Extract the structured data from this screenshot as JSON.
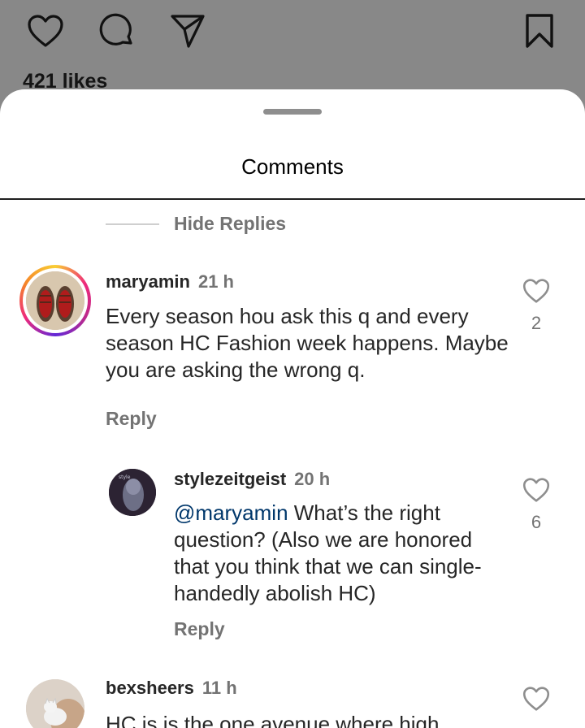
{
  "post": {
    "likes": "421 likes",
    "icons": [
      "heart-icon",
      "comment-icon",
      "share-icon",
      "bookmark-icon"
    ]
  },
  "sheet": {
    "title": "Comments",
    "hide_replies": "Hide Replies"
  },
  "comments": [
    {
      "username": "maryamin",
      "time": "21 h",
      "text": "Every season hou ask this q and every season HC Fashion week happens. Maybe you are asking the wrong q.",
      "reply": "Reply",
      "likes": "2"
    },
    {
      "username": "stylezeitgeist",
      "time": "20 h",
      "mention": "@maryamin",
      "text": " What’s the right question? (Also we are honored that you think that we can single-handedly abolish HC)",
      "reply": "Reply",
      "likes": "6"
    },
    {
      "username": "bexsheers",
      "time": "11 h",
      "text": "HC is is the one avenue where high"
    }
  ],
  "colors": {
    "mention": "#00376b",
    "muted": "#737373",
    "text": "#262626"
  }
}
